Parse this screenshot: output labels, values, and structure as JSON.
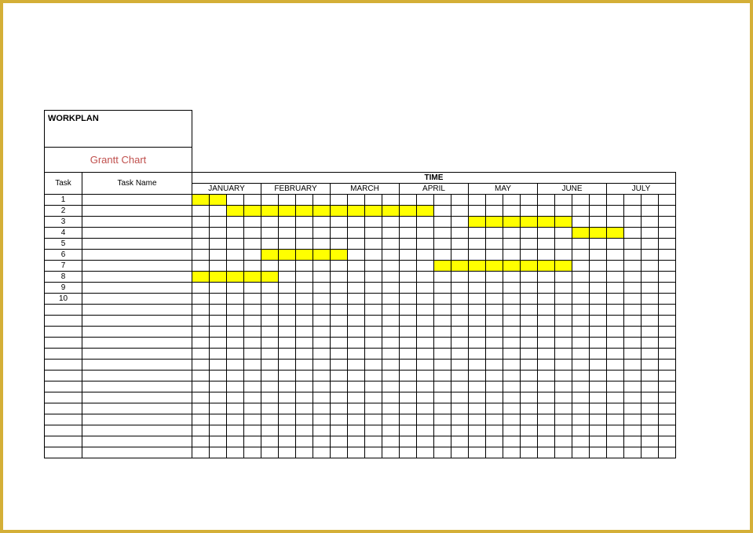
{
  "title": "WORKPLAN",
  "subtitle": "Grantt Chart",
  "headers": {
    "time": "TIME",
    "task": "Task",
    "taskname": "Task Name"
  },
  "months": [
    "JANUARY",
    "FEBRUARY",
    "MARCH",
    "APRIL",
    "MAY",
    "JUNE",
    "JULY"
  ],
  "task_numbers": [
    "1",
    "2",
    "3",
    "4",
    "5",
    "6",
    "7",
    "8",
    "9",
    "10"
  ],
  "chart_data": {
    "type": "bar",
    "title": "WORKPLAN Grantt Chart",
    "xlabel": "TIME",
    "ylabel": "Task",
    "categories": [
      "JANUARY",
      "FEBRUARY",
      "MARCH",
      "APRIL",
      "MAY",
      "JUNE",
      "JULY"
    ],
    "weeks_per_month": 4,
    "total_weeks": 28,
    "series": [
      {
        "name": "Task 1",
        "filled_weeks": [
          1,
          2
        ]
      },
      {
        "name": "Task 2",
        "filled_weeks": [
          3,
          4,
          5,
          6,
          7,
          8,
          9,
          10,
          11,
          12,
          13,
          14
        ]
      },
      {
        "name": "Task 3",
        "filled_weeks": [
          17,
          18,
          19,
          20,
          21,
          22
        ]
      },
      {
        "name": "Task 4",
        "filled_weeks": [
          23,
          24,
          25
        ]
      },
      {
        "name": "Task 5",
        "filled_weeks": []
      },
      {
        "name": "Task 6",
        "filled_weeks": [
          5,
          6,
          7,
          8,
          9
        ]
      },
      {
        "name": "Task 7",
        "filled_weeks": [
          15,
          16,
          17,
          18,
          19,
          20,
          21,
          22
        ]
      },
      {
        "name": "Task 8",
        "filled_weeks": [
          1,
          2,
          3,
          4,
          5
        ]
      },
      {
        "name": "Task 9",
        "filled_weeks": []
      },
      {
        "name": "Task 10",
        "filled_weeks": []
      }
    ],
    "extra_blank_rows": 14
  }
}
